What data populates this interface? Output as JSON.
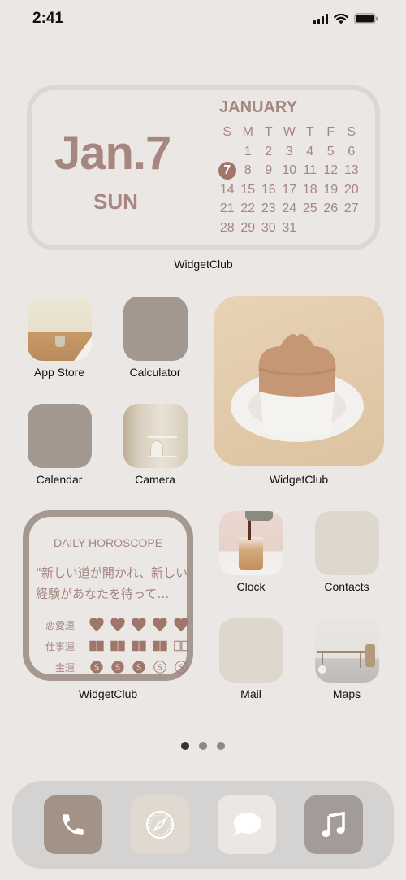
{
  "status_bar": {
    "time": "2:41",
    "icons": [
      "cellular-signal-icon",
      "wifi-icon",
      "battery-icon"
    ]
  },
  "calendar_widget": {
    "big_date": "Jan.7",
    "weekday": "SUN",
    "month": "JANUARY",
    "day_headers": [
      "S",
      "M",
      "T",
      "W",
      "T",
      "F",
      "S"
    ],
    "days": [
      "",
      "1",
      "2",
      "3",
      "4",
      "5",
      "6",
      "7",
      "8",
      "9",
      "10",
      "11",
      "12",
      "13",
      "14",
      "15",
      "16",
      "17",
      "18",
      "19",
      "20",
      "21",
      "22",
      "23",
      "24",
      "25",
      "26",
      "27",
      "28",
      "29",
      "30",
      "31",
      "",
      "",
      ""
    ],
    "today": "7",
    "label": "WidgetClub",
    "accent_color": "#a58680"
  },
  "apps": {
    "app_store": "App Store",
    "calculator": "Calculator",
    "calendar": "Calendar",
    "camera": "Camera",
    "clock": "Clock",
    "contacts": "Contacts",
    "mail": "Mail",
    "maps": "Maps"
  },
  "photo_widget": {
    "label": "WidgetClub"
  },
  "horoscope_widget": {
    "title": "DAILY HOROSCOPE",
    "quote": "\"新しい道が開かれ、新しい経験があなたを待って…",
    "rows": [
      {
        "label": "恋愛運",
        "icon": "heart-icon",
        "filled": 5,
        "total": 5
      },
      {
        "label": "仕事運",
        "icon": "book-icon",
        "filled": 4,
        "total": 5
      },
      {
        "label": "金運",
        "icon": "coin-icon",
        "filled": 3,
        "total": 5
      }
    ],
    "label": "WidgetClub"
  },
  "page_indicator": {
    "pages": 3,
    "current": 1
  },
  "dock": {
    "apps": [
      "phone-icon",
      "safari-icon",
      "messages-icon",
      "music-icon"
    ]
  }
}
